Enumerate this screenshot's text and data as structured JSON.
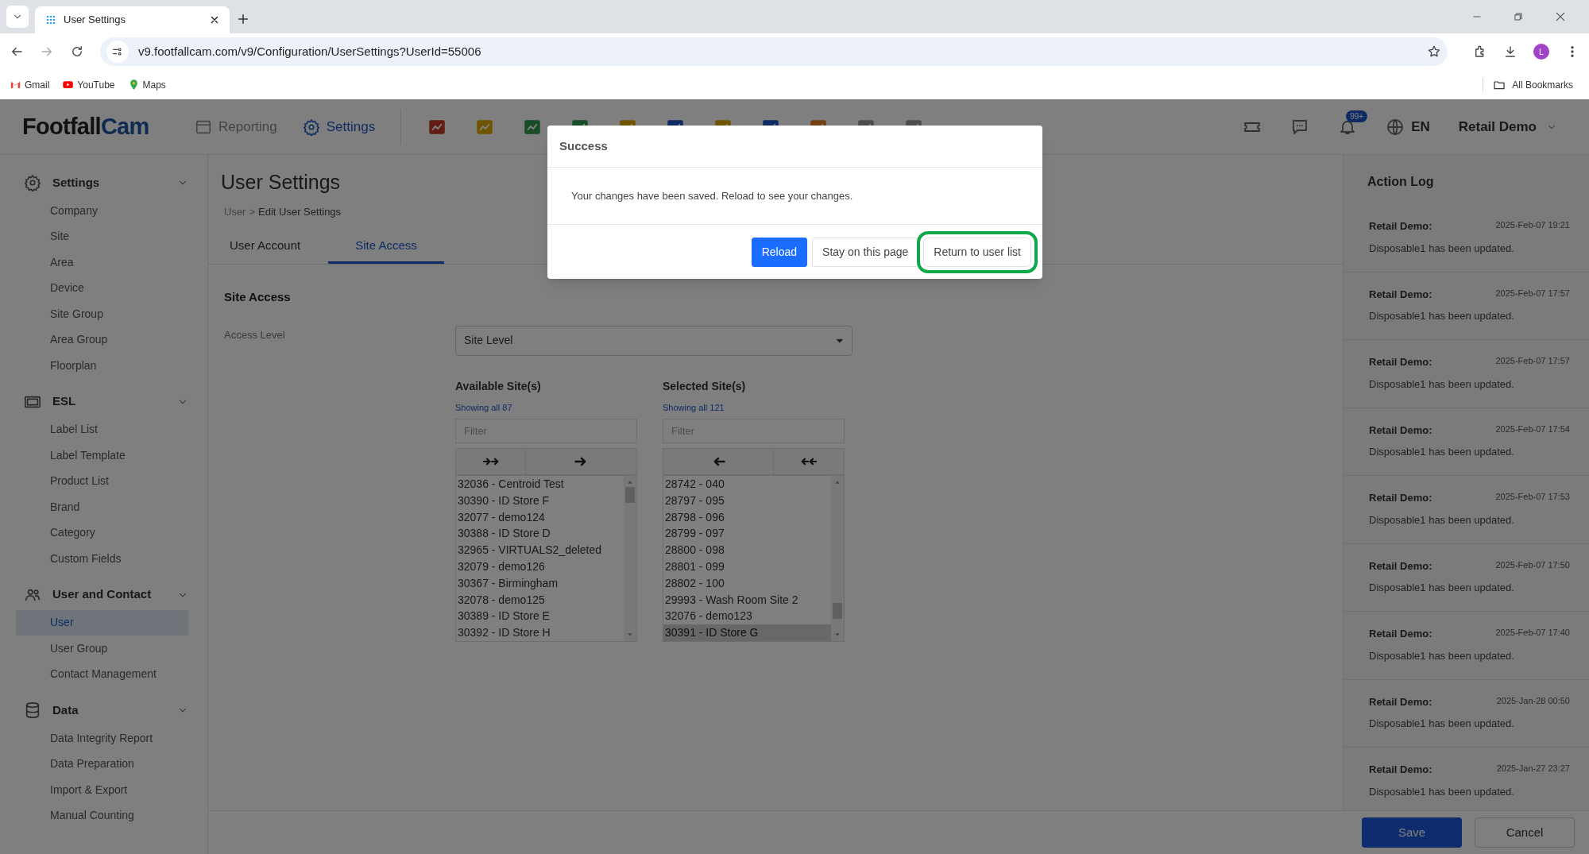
{
  "browser": {
    "tab_title": "User Settings",
    "url": "v9.footfallcam.com/v9/Configuration/UserSettings?UserId=55006",
    "bookmarks": [
      "Gmail",
      "YouTube",
      "Maps"
    ],
    "all_bookmarks": "All Bookmarks",
    "profile_initial": "L"
  },
  "header": {
    "logo_first": "Footfall",
    "logo_second": "Cam",
    "nav": [
      {
        "label": "Reporting",
        "selected": false
      },
      {
        "label": "Settings",
        "selected": true
      }
    ],
    "notification_badge": "99+",
    "language": "EN",
    "user": "Retail Demo"
  },
  "sidebar": [
    {
      "title": "Settings",
      "kind": "gear",
      "items": [
        {
          "label": "Company",
          "selected": false
        },
        {
          "label": "Site",
          "selected": false
        },
        {
          "label": "Area",
          "selected": false
        },
        {
          "label": "Device",
          "selected": false
        },
        {
          "label": "Site Group",
          "selected": false
        },
        {
          "label": "Area Group",
          "selected": false
        },
        {
          "label": "Floorplan",
          "selected": false
        }
      ]
    },
    {
      "title": "ESL",
      "kind": "screen",
      "items": [
        {
          "label": "Label List",
          "selected": false
        },
        {
          "label": "Label Template",
          "selected": false
        },
        {
          "label": "Product List",
          "selected": false
        },
        {
          "label": "Brand",
          "selected": false
        },
        {
          "label": "Category",
          "selected": false
        },
        {
          "label": "Custom Fields",
          "selected": false
        }
      ]
    },
    {
      "title": "User and Contact",
      "kind": "people",
      "items": [
        {
          "label": "User",
          "selected": true
        },
        {
          "label": "User Group",
          "selected": false
        },
        {
          "label": "Contact Management",
          "selected": false
        }
      ]
    },
    {
      "title": "Data",
      "kind": "database",
      "items": [
        {
          "label": "Data Integrity Report",
          "selected": false
        },
        {
          "label": "Data Preparation",
          "selected": false
        },
        {
          "label": "Import & Export",
          "selected": false
        },
        {
          "label": "Manual Counting",
          "selected": false
        }
      ]
    }
  ],
  "page": {
    "title": "User Settings",
    "breadcrumb": {
      "parent": "User",
      "separator": ">",
      "current": "Edit User Settings"
    },
    "tabs": [
      {
        "label": "User Account",
        "selected": false
      },
      {
        "label": "Site Access",
        "selected": true
      }
    ],
    "section_title": "Site Access",
    "access_level": {
      "label": "Access Level",
      "value": "Site Level"
    },
    "available": {
      "title": "Available Site(s)",
      "count": "Showing all 87",
      "filter_placeholder": "Filter",
      "items": [
        {
          "label": "32036 - Centroid Test",
          "selected": false
        },
        {
          "label": "30390 - ID Store F",
          "selected": false
        },
        {
          "label": "32077 - demo124",
          "selected": false
        },
        {
          "label": "30388 - ID Store D",
          "selected": false
        },
        {
          "label": "32965 - VIRTUALS2_deleted",
          "selected": false
        },
        {
          "label": "32079 - demo126",
          "selected": false
        },
        {
          "label": "30367 - Birmingham",
          "selected": false
        },
        {
          "label": "32078 - demo125",
          "selected": false
        },
        {
          "label": "30389 - ID Store E",
          "selected": false
        },
        {
          "label": "30392 - ID Store H",
          "selected": false
        }
      ]
    },
    "chosen": {
      "title": "Selected Site(s)",
      "count": "Showing all 121",
      "filter_placeholder": "Filter",
      "items": [
        {
          "label": "28742 - 040",
          "selected": false
        },
        {
          "label": "28797 - 095",
          "selected": false
        },
        {
          "label": "28798 - 096",
          "selected": false
        },
        {
          "label": "28799 - 097",
          "selected": false
        },
        {
          "label": "28800 - 098",
          "selected": false
        },
        {
          "label": "28801 - 099",
          "selected": false
        },
        {
          "label": "28802 - 100",
          "selected": false
        },
        {
          "label": "29993 - Wash Room Site 2",
          "selected": false
        },
        {
          "label": "32076 - demo123",
          "selected": false
        },
        {
          "label": "30391 - ID Store G",
          "selected": true
        }
      ]
    }
  },
  "action_log": {
    "title": "Action Log",
    "entries": [
      {
        "user": "Retail Demo:",
        "time": "2025-Feb-07 19:21",
        "message": "Disposable1 has been updated."
      },
      {
        "user": "Retail Demo:",
        "time": "2025-Feb-07 17:57",
        "message": "Disposable1 has been updated."
      },
      {
        "user": "Retail Demo:",
        "time": "2025-Feb-07 17:57",
        "message": "Disposable1 has been updated."
      },
      {
        "user": "Retail Demo:",
        "time": "2025-Feb-07 17:54",
        "message": "Disposable1 has been updated."
      },
      {
        "user": "Retail Demo:",
        "time": "2025-Feb-07 17:53",
        "message": "Disposable1 has been updated."
      },
      {
        "user": "Retail Demo:",
        "time": "2025-Feb-07 17:50",
        "message": "Disposable1 has been updated."
      },
      {
        "user": "Retail Demo:",
        "time": "2025-Feb-07 17:40",
        "message": "Disposable1 has been updated."
      },
      {
        "user": "Retail Demo:",
        "time": "2025-Jan-28 00:50",
        "message": "Disposable1 has been updated."
      },
      {
        "user": "Retail Demo:",
        "time": "2025-Jan-27 23:27",
        "message": "Disposable1 has been updated."
      }
    ]
  },
  "footer_buttons": [
    {
      "label": "Save",
      "kind": "primary"
    },
    {
      "label": "Cancel",
      "kind": "default"
    }
  ],
  "modal": {
    "title": "Success",
    "message": "Your changes have been saved. Reload to see your changes.",
    "buttons": [
      {
        "label": "Reload",
        "kind": "primary",
        "highlighted": false
      },
      {
        "label": "Stay on this page",
        "kind": "default",
        "highlighted": false
      },
      {
        "label": "Return to user list",
        "kind": "default",
        "highlighted": true
      }
    ]
  }
}
